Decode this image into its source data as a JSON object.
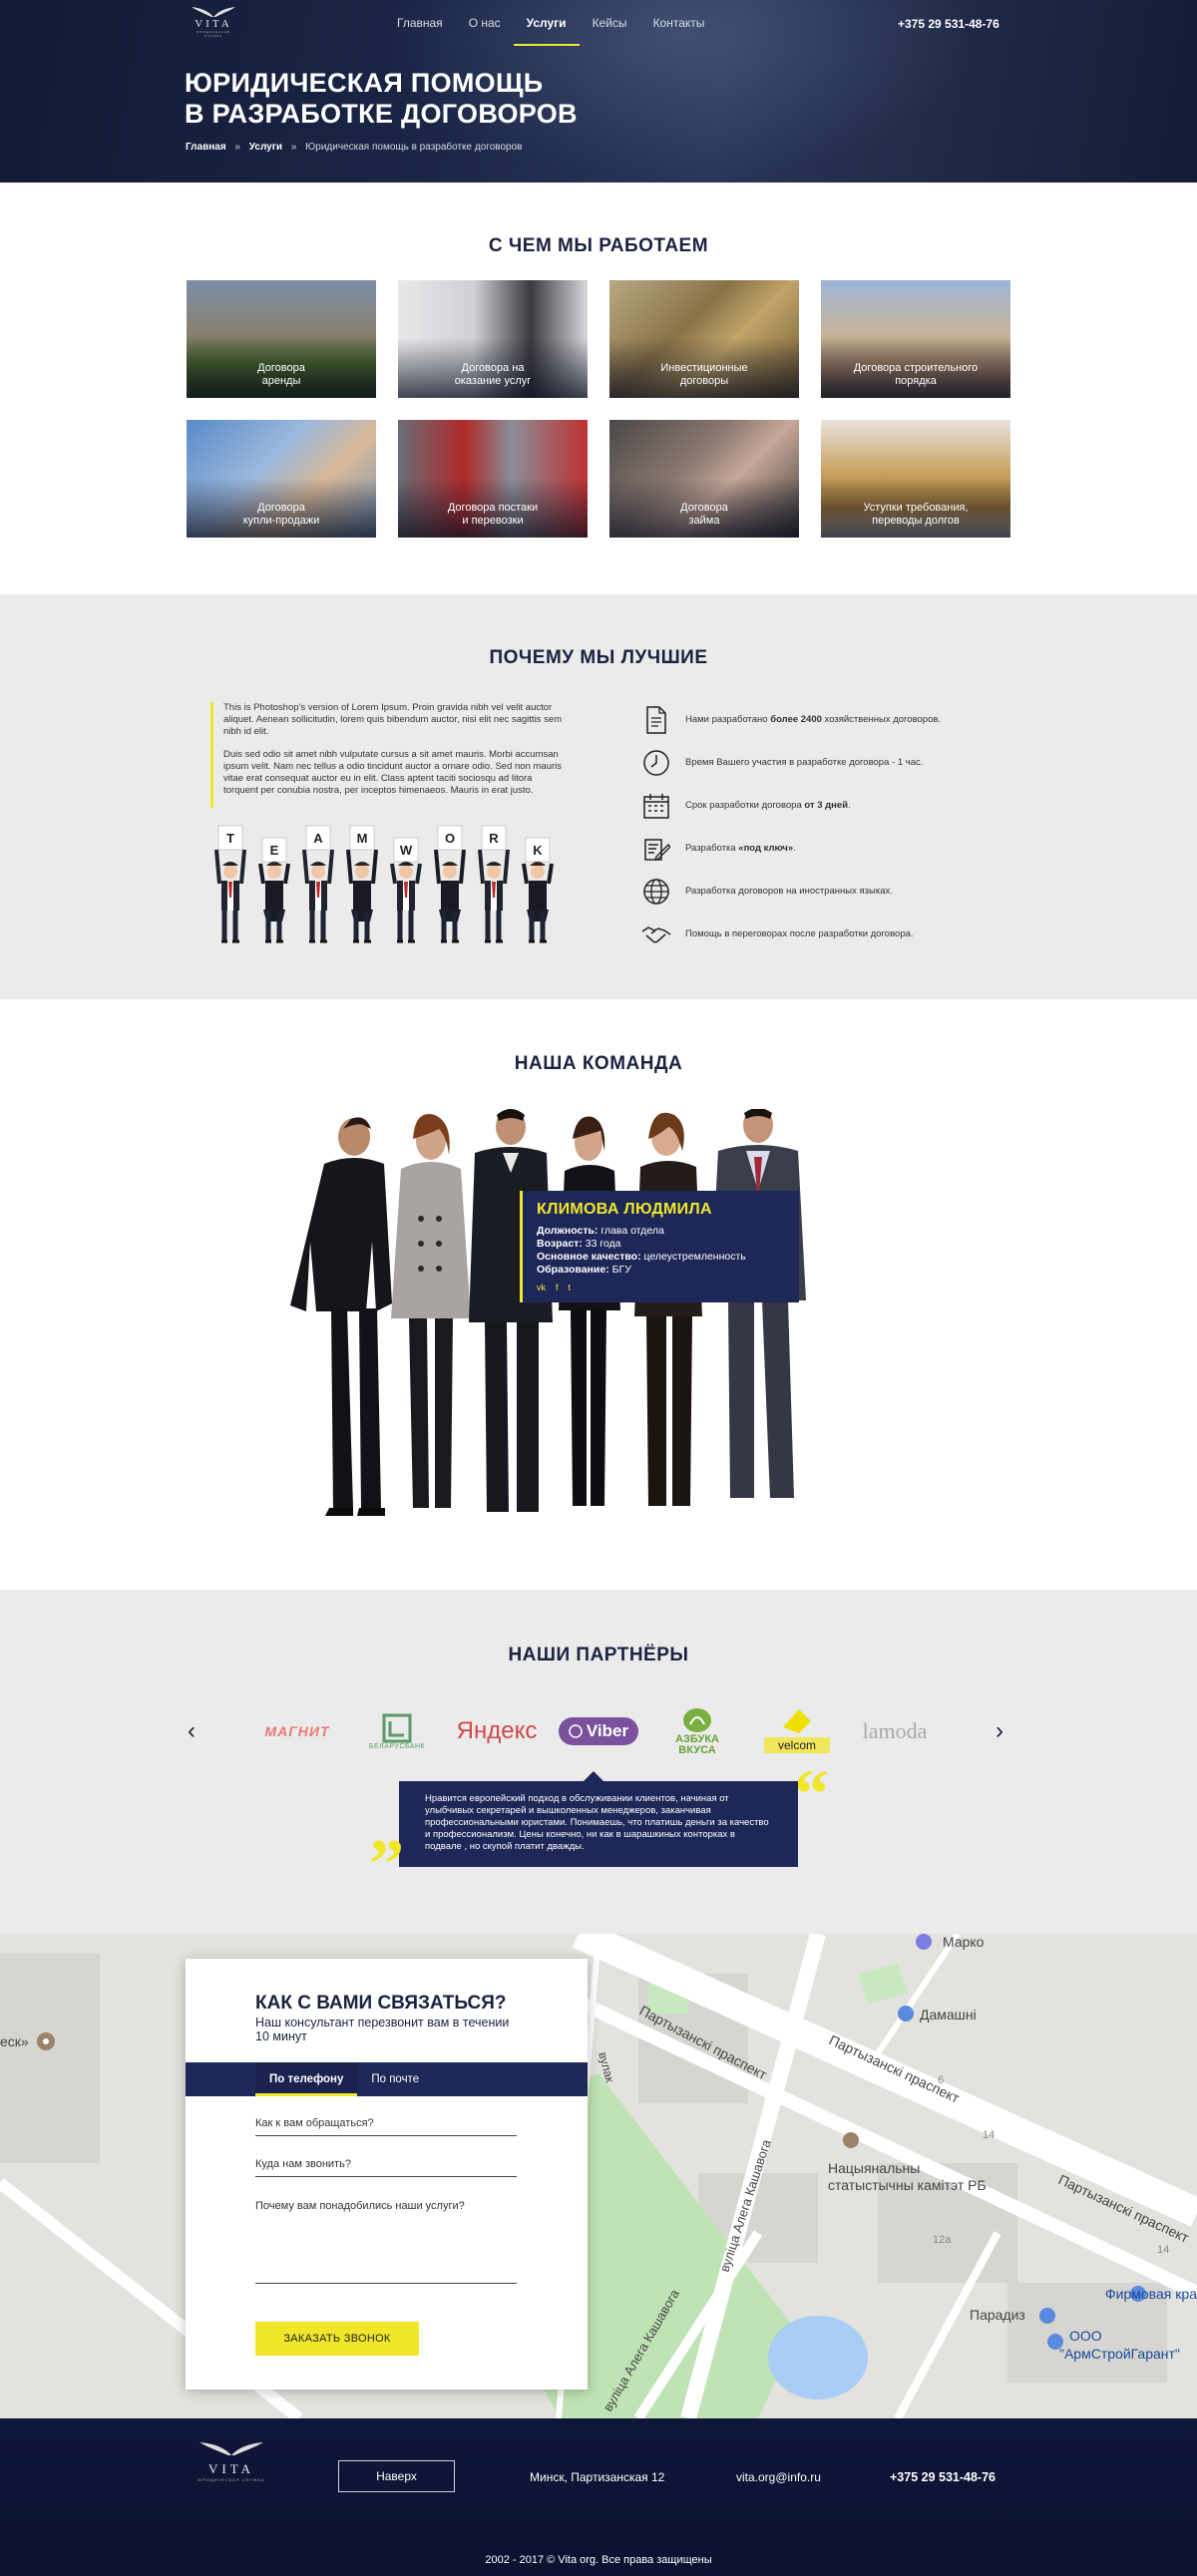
{
  "header": {
    "logo_name": "VITA",
    "logo_sub": "ЮРИДИЧЕСКАЯ СЛУЖБА",
    "nav": [
      "Главная",
      "О нас",
      "Услуги",
      "Кейсы",
      "Контакты"
    ],
    "nav_active": "Услуги",
    "phone": "+375 29 531-48-76"
  },
  "hero": {
    "title_line1": "ЮРИДИЧЕСКАЯ ПОМОЩЬ",
    "title_line2": "В РАЗРАБОТКЕ ДОГОВОРОВ",
    "breadcrumbs": [
      "Главная",
      "»",
      "Услуги",
      "»",
      "Юридическая помощь в разработке договоров"
    ]
  },
  "work": {
    "title": "С ЧЕМ МЫ РАБОТАЕМ",
    "tiles": [
      {
        "line1": "Договора",
        "line2": "аренды"
      },
      {
        "line1": "Договора на",
        "line2": "оказание услуг"
      },
      {
        "line1": "Инвестиционные",
        "line2": "договоры"
      },
      {
        "line1": "Договора строительного",
        "line2": "порядка"
      },
      {
        "line1": "Договора",
        "line2": "купли-продажи"
      },
      {
        "line1": "Договора постаки",
        "line2": "и перевозки"
      },
      {
        "line1": "Договора",
        "line2": "займа"
      },
      {
        "line1": "Уступки требования,",
        "line2": "переводы долгов"
      }
    ]
  },
  "why": {
    "title": "ПОЧЕМУ МЫ ЛУЧШИЕ",
    "para1": "This is Photoshop's version  of Lorem Ipsum. Proin gravida nibh vel velit auctor aliquet. Aenean sollicitudin, lorem quis bibendum auctor, nisi elit nec sagittis sem nibh id elit.",
    "para2": "Duis sed odio sit amet nibh vulputate cursus a sit amet mauris. Morbi accumsan ipsum velit. Nam nec tellus a odio tincidunt auctor a ornare odio. Sed non  mauris vitae erat consequat auctor eu in elit. Class aptent taciti sociosqu ad litora torquent per conubia nostra, per inceptos himenaeos. Mauris in erat justo.",
    "teamwork_letters": [
      "T",
      "E",
      "A",
      "M",
      "W",
      "O",
      "R",
      "K"
    ],
    "benefits": [
      {
        "icon": "document-icon",
        "pre": "Нами разработано ",
        "bold": "более 2400",
        "post": " хозяйственных договоров."
      },
      {
        "icon": "clock-icon",
        "pre": "Время Вашего участия в разработке договора - 1 час.",
        "bold": "",
        "post": ""
      },
      {
        "icon": "calendar-icon",
        "pre": "Срок разработки договора ",
        "bold": "от 3 дней",
        "post": "."
      },
      {
        "icon": "edit-icon",
        "pre": "Разработка ",
        "bold": "«под ключ»",
        "post": "."
      },
      {
        "icon": "globe-icon",
        "pre": "Разработка договоров на иностранных языках.",
        "bold": "",
        "post": ""
      },
      {
        "icon": "handshake-icon",
        "pre": "Помощь в переговорах после разработки договора.",
        "bold": "",
        "post": ""
      }
    ]
  },
  "team": {
    "title": "НАША КОМАНДА",
    "card": {
      "name": "КЛИМОВА ЛЮДМИЛА",
      "position_label": "Должность:",
      "position": "глава отдела",
      "age_label": "Возраст:",
      "age": "33 года",
      "quality_label": "Основное качество:",
      "quality": "целеустремленность",
      "edu_label": "Образование:",
      "edu": "БГУ",
      "social": [
        "vk",
        "f",
        "t"
      ]
    }
  },
  "partners": {
    "title": "НАШИ ПАРТНЁРЫ",
    "logos": [
      "МАГНИТ",
      "БЕЛАРУСБАНК",
      "Яндекс",
      "Viber",
      "АЗБУКА ВКУСА",
      "velcom",
      "lamoda"
    ],
    "prev": "‹",
    "next": "›",
    "quote": "Нравится европейский подход в обслуживании клиентов, начиная от улыбчивых секретарей и вышколенных менеджеров, заканчивая профессиональными юристами. Понимаешь, что платишь деньги за качество и профессионализм. Цены конечно, ни как в шарашкиных конторках в подвале , но скупой платит дважды."
  },
  "contact": {
    "title": "КАК С ВАМИ СВЯЗАТЬСЯ?",
    "subtitle": "Наш консультант перезвонит вам в течении 10 минут",
    "tabs": [
      "По телефону",
      "По почте"
    ],
    "fields": [
      "Как к вам обращаться?",
      "Куда нам звонить?",
      "Почему вам понадобились наши услуги?"
    ],
    "button": "ЗАКАЗАТЬ ЗВОНОК"
  },
  "map": {
    "labels": [
      "Партызанскі праспект",
      "Партызанскі праспект",
      "Партызанскі праспект",
      "вуліца Алега Кашавога",
      "вуліца Алега Кашавога",
      "Нацыянальны",
      "статыстычны камітэт РБ",
      "Марко",
      "Дамашні",
      "Парадиз",
      "ООО",
      "\"АрмСтройГарант\"",
      "Фирмовая кра",
      "еск»",
      "12а",
      "14",
      "14",
      "6",
      "вулак"
    ]
  },
  "footer": {
    "to_top": "Наверх",
    "address": "Минск, Партизанская 12",
    "email": "vita.org@info.ru",
    "phone": "+375 29 531-48-76",
    "copyright": "2002 - 2017  ©  Vita org. Все права защищены"
  },
  "colors": {
    "accent": "#f0e62a",
    "navy": "#1e2858",
    "dark": "#1b2240",
    "grey_bg": "#ebebeb"
  }
}
